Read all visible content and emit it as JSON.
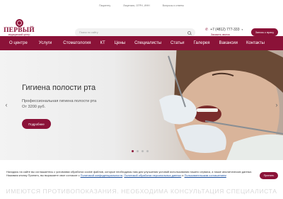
{
  "topbar": {
    "links": [
      "Пациенту",
      "Лицензия, ОГРН, ИНН",
      "Вопросы и ответы"
    ]
  },
  "logo": {
    "title": "ПЕРВЫЙ",
    "subtitle": "медицинский центр"
  },
  "search": {
    "placeholder": "Поиск по сайту"
  },
  "contact": {
    "phone": "+7 (4812) 777-333",
    "callback": "Заказать звонок"
  },
  "header_cta": "Запись к врачу",
  "nav": {
    "items": [
      "О центре",
      "Услуги",
      "Стоматология",
      "КТ",
      "Цены",
      "Специалисты",
      "Статьи",
      "Галерея",
      "Вакансии",
      "Контакты"
    ]
  },
  "hero": {
    "title": "Гигиена полости рта",
    "subtitle": "Профессиональная гигиена полости рта",
    "price": "От 3200 руб.",
    "button": "Подробнее"
  },
  "cookie": {
    "text": "Находясь на сайте вы соглашаетесь с условиями обработки cookie файлов, которые необходимы нам для улучшения условий использования нашего сервиса, а также аналитических данных. Нажимая кнопку Принять, вы выражаете свое согласие с",
    "link1": "Политикой конфиденциальности",
    "link2": "Политикой обработки персональных данных",
    "and": "и",
    "link3": "Пользовательским соглашением",
    "button": "Принять"
  },
  "disclaimer": "ИМЕЮТСЯ ПРОТИВОПОКАЗАНИЯ. НЕОБХОДИМА КОНСУЛЬТАЦИЯ СПЕЦИАЛИСТА",
  "colors": {
    "brand": "#8b1238"
  }
}
